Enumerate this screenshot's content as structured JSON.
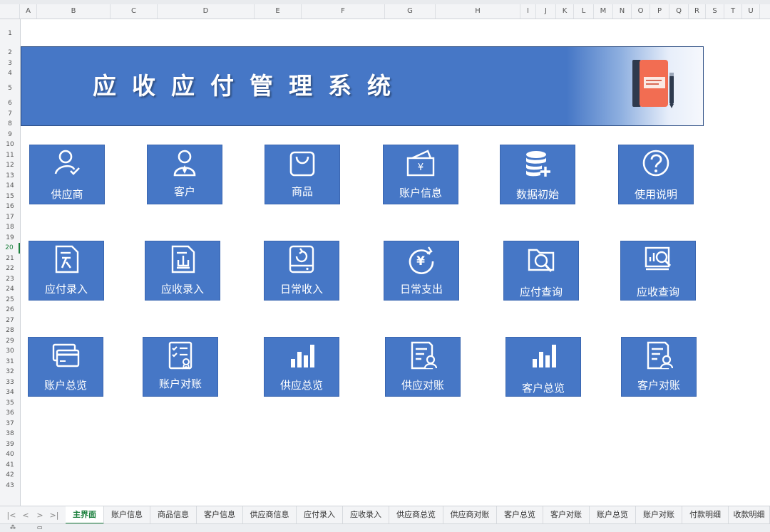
{
  "columns": [
    "A",
    "B",
    "C",
    "D",
    "E",
    "F",
    "G",
    "H",
    "I",
    "J",
    "K",
    "L",
    "M",
    "N",
    "O",
    "P",
    "Q",
    "R",
    "S",
    "T",
    "U"
  ],
  "rows": [
    "1",
    "2",
    "3",
    "4",
    "5",
    "6",
    "7",
    "8",
    "9",
    "10",
    "11",
    "12",
    "13",
    "14",
    "15",
    "16",
    "17",
    "18",
    "19",
    "20",
    "21",
    "22",
    "23",
    "24",
    "25",
    "26",
    "27",
    "28",
    "29",
    "30",
    "31",
    "32",
    "33",
    "34",
    "35",
    "36",
    "37",
    "38",
    "39",
    "40",
    "41",
    "42",
    "43"
  ],
  "selected_row": "20",
  "banner": {
    "title": "应收应付管理系统"
  },
  "tiles": [
    {
      "label": "供应商",
      "icon": "user-check-icon"
    },
    {
      "label": "客户",
      "icon": "user-tie-icon"
    },
    {
      "label": "商品",
      "icon": "shopping-bag-icon"
    },
    {
      "label": "账户信息",
      "icon": "wallet-yen-icon"
    },
    {
      "label": "数据初始",
      "icon": "database-add-icon"
    },
    {
      "label": "使用说明",
      "icon": "help-circle-icon"
    },
    {
      "label": "应付录入",
      "icon": "document-in-icon"
    },
    {
      "label": "应收录入",
      "icon": "document-out-icon"
    },
    {
      "label": "日常收入",
      "icon": "refresh-drive-icon"
    },
    {
      "label": "日常支出",
      "icon": "yen-cycle-icon"
    },
    {
      "label": "应付查询",
      "icon": "folder-search-icon"
    },
    {
      "label": "应收查询",
      "icon": "chart-search-icon"
    },
    {
      "label": "账户总览",
      "icon": "cards-icon"
    },
    {
      "label": "账户对账",
      "icon": "checklist-icon"
    },
    {
      "label": "供应总览",
      "icon": "bar-chart-icon"
    },
    {
      "label": "供应对账",
      "icon": "report-user-icon"
    },
    {
      "label": "客户总览",
      "icon": "bar-chart-icon"
    },
    {
      "label": "客户对账",
      "icon": "report-user-icon"
    }
  ],
  "sheet_tabs": [
    "主界面",
    "账户信息",
    "商品信息",
    "客户信息",
    "供应商信息",
    "应付录入",
    "应收录入",
    "供应商总览",
    "供应商对账",
    "客户总览",
    "客户对账",
    "账户总览",
    "账户对账",
    "付款明细",
    "收款明细"
  ],
  "active_tab": "主界面",
  "nav_buttons": [
    "|<",
    "<",
    ">",
    ">|"
  ],
  "colors": {
    "tile": "#4677c6",
    "banner": "#4677c6",
    "active_tab": "#1a7f3c"
  }
}
